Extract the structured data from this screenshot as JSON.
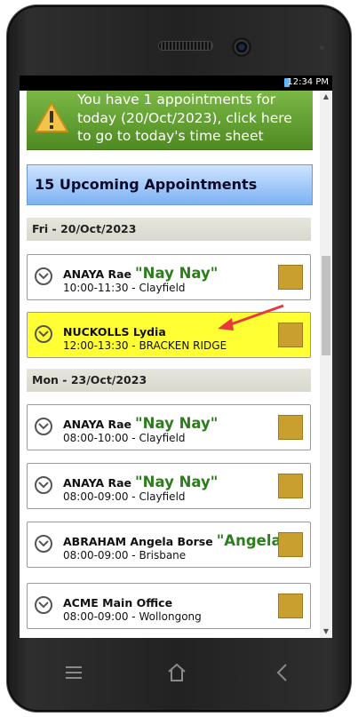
{
  "status_bar": {
    "time": "12:34 PM"
  },
  "banner": {
    "text": "You have 1 appointments for today (20/Oct/2023), click here to go to today's time sheet"
  },
  "upcoming": {
    "title": "15 Upcoming Appointments"
  },
  "days": [
    {
      "label": "Fri - 20/Oct/2023",
      "appointments": [
        {
          "name": "ANAYA Rae",
          "nickname": "\"Nay Nay\"",
          "time": "10:00-11:30 - Clayfield",
          "highlighted": false
        },
        {
          "name": "NUCKOLLS Lydia",
          "nickname": "",
          "time": "12:00-13:30 - BRACKEN RIDGE",
          "highlighted": true
        }
      ]
    },
    {
      "label": "Mon - 23/Oct/2023",
      "appointments": [
        {
          "name": "ANAYA Rae",
          "nickname": "\"Nay Nay\"",
          "time": "08:00-10:00 - Clayfield",
          "highlighted": false
        },
        {
          "name": "ANAYA Rae",
          "nickname": "\"Nay Nay\"",
          "time": "08:00-09:00 - Clayfield",
          "highlighted": false
        },
        {
          "name": "ABRAHAM Angela Borse",
          "nickname": "\"Angela\"",
          "time": "08:00-09:00 - Brisbane",
          "highlighted": false
        },
        {
          "name": "ACME Main Office",
          "nickname": "",
          "time": "08:00-09:00 - Wollongong",
          "highlighted": false
        }
      ]
    }
  ],
  "colors": {
    "banner": "#5a9a2a",
    "header": "#7db2f3",
    "highlight": "#ffff33",
    "swatch": "#c9a030",
    "nickname": "#2e7d1d",
    "arrow": "#e83a3a"
  },
  "icons": [
    "warning-icon",
    "chevron-down-icon",
    "menu-icon",
    "home-icon",
    "back-icon",
    "battery-icon"
  ]
}
